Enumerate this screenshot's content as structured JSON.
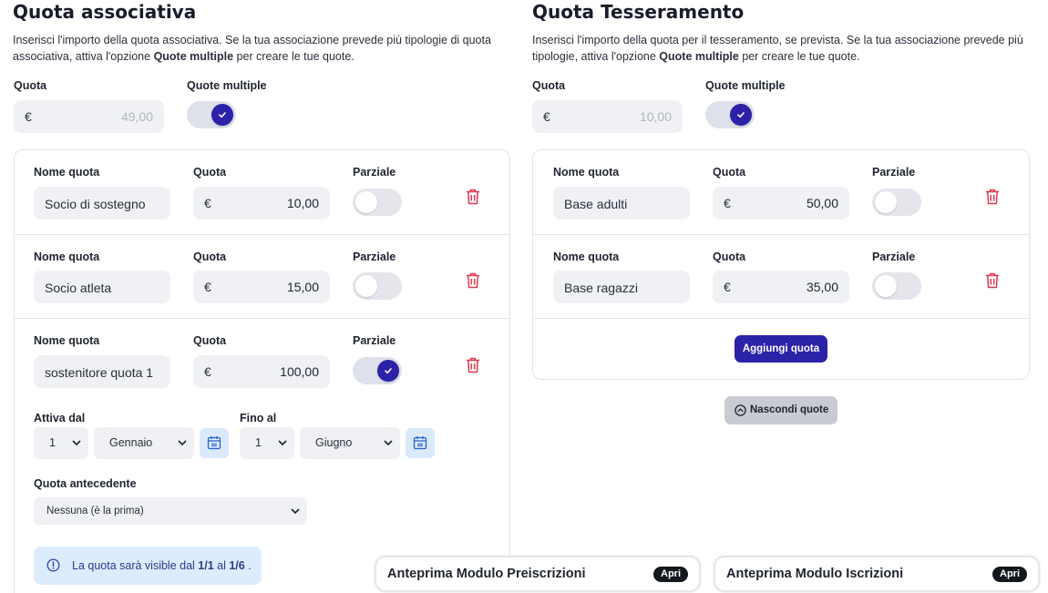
{
  "left": {
    "title": "Quota associativa",
    "description_a": "Inserisci l'importo della quota associativa. Se la tua associazione prevede più tipologie di quota associativa, attiva l'opzione ",
    "description_bold": "Quote multiple",
    "description_b": " per creare le tue quote.",
    "quota_label": "Quota",
    "currency": "€",
    "quota_value": "49,00",
    "multiple_label": "Quote multiple",
    "multiple_on": true,
    "rows": [
      {
        "name_label": "Nome quota",
        "name": "Socio di sostegno",
        "quota_label": "Quota",
        "quota": "10,00",
        "partial_label": "Parziale",
        "partial_on": false
      },
      {
        "name_label": "Nome quota",
        "name": "Socio atleta",
        "quota_label": "Quota",
        "quota": "15,00",
        "partial_label": "Parziale",
        "partial_on": false
      },
      {
        "name_label": "Nome quota",
        "name": "sostenitore quota 1",
        "quota_label": "Quota",
        "quota": "100,00",
        "partial_label": "Parziale",
        "partial_on": true
      }
    ],
    "active_from_label": "Attiva dal",
    "active_from_day": "1",
    "active_from_month": "Gennaio",
    "until_label": "Fino al",
    "until_day": "1",
    "until_month": "Giugno",
    "previous_label": "Quota antecedente",
    "previous_value": "Nessuna (è la prima)",
    "info_a": "La quota sarà visible dal ",
    "info_from": "1/1",
    "info_mid": " al ",
    "info_to": "1/6",
    "info_end": " ."
  },
  "right": {
    "title": "Quota Tesseramento",
    "description_a": "Inserisci l'importo della quota per il tesseramento, se prevista. Se la tua associazione prevede più tipologie, attiva l'opzione ",
    "description_bold": "Quote multiple",
    "description_b": " per creare le tue quote.",
    "quota_label": "Quota",
    "currency": "€",
    "quota_value": "10,00",
    "multiple_label": "Quote multiple",
    "multiple_on": true,
    "rows": [
      {
        "name_label": "Nome quota",
        "name": "Base adulti",
        "quota_label": "Quota",
        "quota": "50,00",
        "partial_label": "Parziale",
        "partial_on": false
      },
      {
        "name_label": "Nome quota",
        "name": "Base ragazzi",
        "quota_label": "Quota",
        "quota": "35,00",
        "partial_label": "Parziale",
        "partial_on": false
      }
    ],
    "add_button": "Aggiungi quota",
    "hide_button": "Nascondi quote"
  },
  "previews": [
    {
      "title": "Anteprima Modulo Preiscrizioni",
      "badge": "Apri"
    },
    {
      "title": "Anteprima Modulo Iscrizioni",
      "badge": "Apri"
    }
  ],
  "colors": {
    "accent": "#2b22a8",
    "danger": "#e0394f",
    "info_bg": "#dcecfd"
  }
}
